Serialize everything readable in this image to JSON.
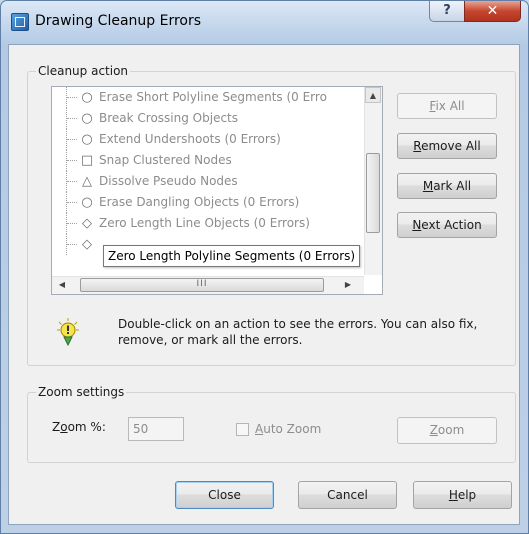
{
  "window": {
    "title": "Drawing Cleanup Errors",
    "help_glyph": "?",
    "close_glyph": "✕"
  },
  "cleanup_group": {
    "legend": "Cleanup action",
    "actions": [
      {
        "icon": "circle-icon",
        "glyph": "○",
        "label": "Erase Short Polyline Segments (0 Erro"
      },
      {
        "icon": "circle-icon",
        "glyph": "○",
        "label": "Break Crossing Objects"
      },
      {
        "icon": "circle-icon",
        "glyph": "○",
        "label": "Extend Undershoots (0 Errors)"
      },
      {
        "icon": "square-icon",
        "glyph": "□",
        "label": "Snap Clustered Nodes"
      },
      {
        "icon": "triangle-icon",
        "glyph": "△",
        "label": "Dissolve Pseudo Nodes"
      },
      {
        "icon": "circle-icon",
        "glyph": "○",
        "label": "Erase Dangling Objects (0 Errors)"
      },
      {
        "icon": "diamond-icon",
        "glyph": "◇",
        "label": "Zero Length Line Objects (0 Errors)"
      },
      {
        "icon": "diamond-icon",
        "glyph": "◇",
        "label": "Zero Length Polyline Segments (0 Errors)"
      }
    ],
    "scroll_thumb_grip": "III",
    "buttons": {
      "fix_all": {
        "pre": "",
        "key": "F",
        "post": "ix All"
      },
      "remove_all": {
        "pre": "",
        "key": "R",
        "post": "emove All"
      },
      "mark_all": {
        "pre": "",
        "key": "M",
        "post": "ark All"
      },
      "next_action": {
        "pre": "",
        "key": "N",
        "post": "ext Action"
      }
    },
    "info_text": "Double-click on an action to see the errors. You can also fix, remove, or mark all the errors."
  },
  "zoom_group": {
    "legend": "Zoom settings",
    "zoom_label": {
      "pre": "Z",
      "key": "o",
      "post": "om %:"
    },
    "zoom_value": "50",
    "auto_zoom": {
      "pre": "",
      "key": "A",
      "post": "uto Zoom",
      "checked": false
    },
    "zoom_button": {
      "pre": "",
      "key": "Z",
      "post": "oom"
    }
  },
  "footer": {
    "close_label": "Close",
    "cancel_label": "Cancel",
    "help_label": {
      "pre": "",
      "key": "H",
      "post": "elp"
    }
  },
  "colors": {
    "title_bar": "#bfd3ea",
    "close_button": "#c6472f",
    "dialog_bg": "#f0f0f0"
  }
}
